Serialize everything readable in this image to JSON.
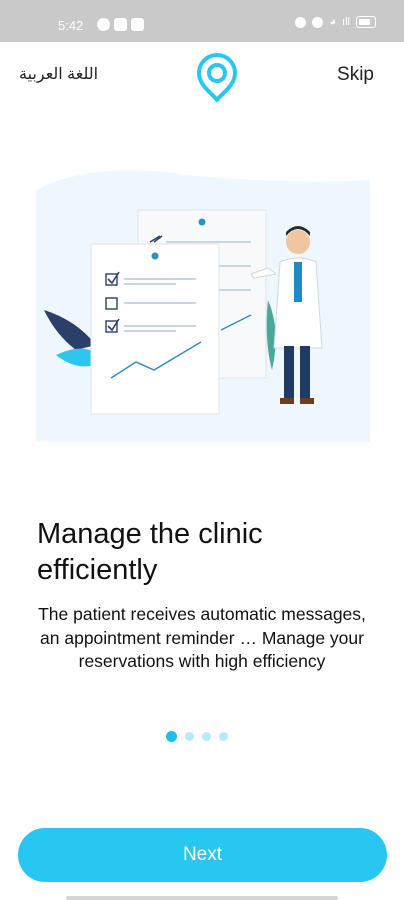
{
  "status_bar": {
    "time": "5:42",
    "left_icons": [
      "whatsapp-icon",
      "cloud-icon",
      "linkedin-icon"
    ],
    "right_icons": [
      "vibrate-icon",
      "alarm-icon",
      "wifi-icon",
      "signal-icon",
      "battery-icon"
    ],
    "signal_label": "ıll",
    "wifi_label": "◕"
  },
  "header": {
    "language_label": "اللغة العربية",
    "skip_label": "Skip",
    "logo_icon": "location-pin-logo-icon",
    "brand_color": "#27c7f2"
  },
  "slide": {
    "illustration": "doctor-with-checklist-illustration",
    "title": "Manage the clinic efficiently",
    "description": "The patient receives automatic messages, an appointment reminder … Manage your reservations with high efficiency"
  },
  "pagination": {
    "total": 4,
    "current": 1
  },
  "footer": {
    "next_label": "Next"
  }
}
